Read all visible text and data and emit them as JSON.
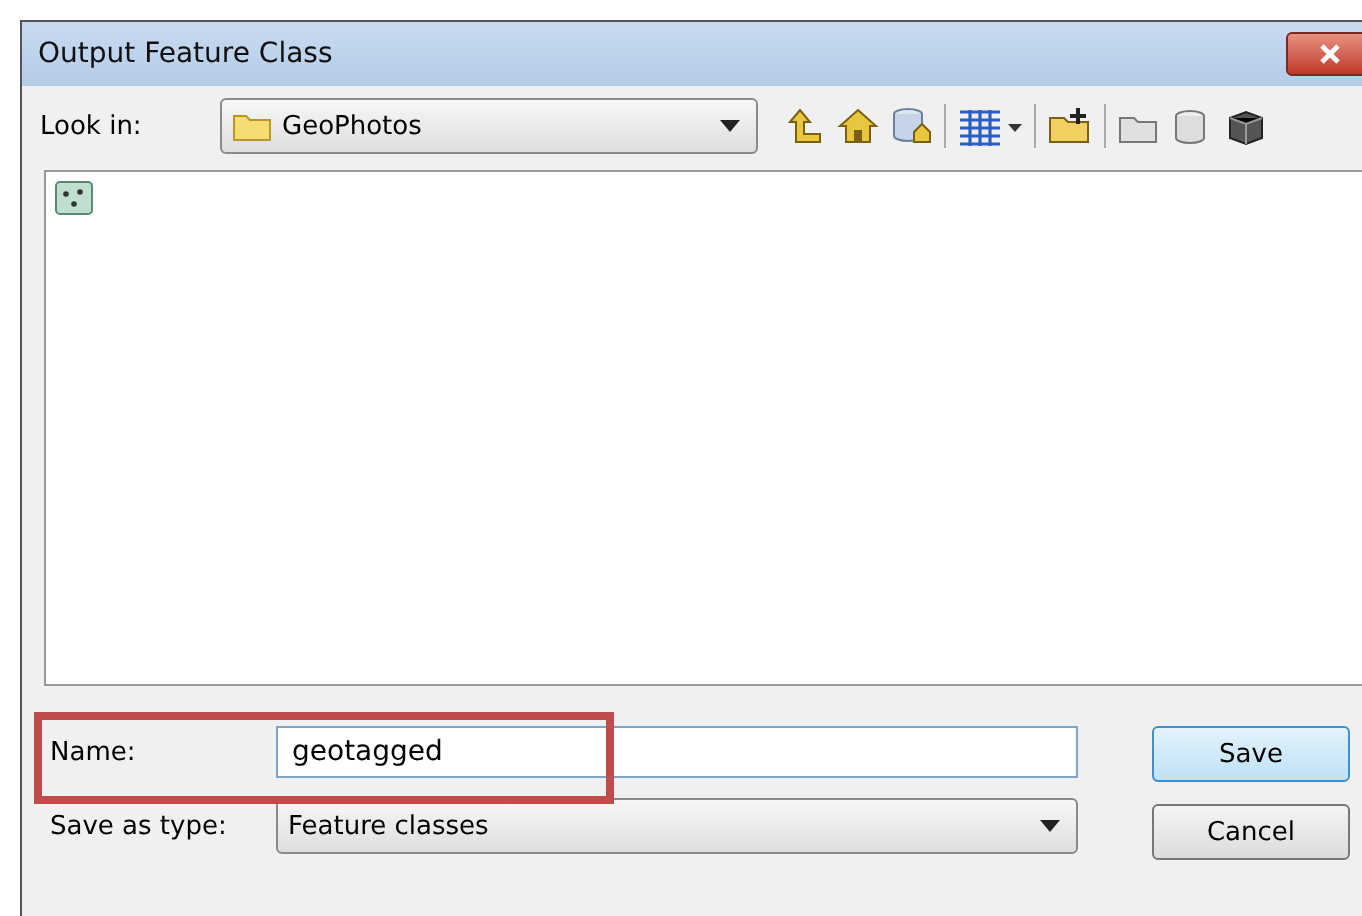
{
  "window": {
    "title": "Output Feature Class"
  },
  "look_in": {
    "label": "Look in:",
    "value": "GeoPhotos"
  },
  "file_list": {
    "items": [
      {
        "kind": "point-feature-class"
      }
    ]
  },
  "name_field": {
    "label": "Name:",
    "value": "geotagged",
    "highlighted": true
  },
  "type_field": {
    "label": "Save as type:",
    "value": "Feature classes"
  },
  "buttons": [
    {
      "label": "Save",
      "default": true
    },
    {
      "label": "Cancel",
      "default": false
    }
  ]
}
